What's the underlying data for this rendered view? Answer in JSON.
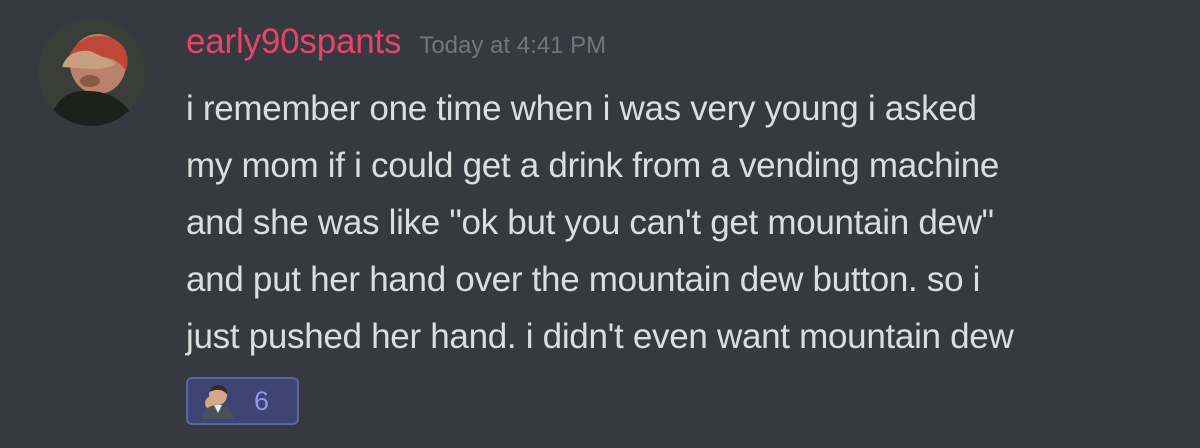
{
  "message": {
    "username": "early90spants",
    "timestamp": "Today at 4:41 PM",
    "lines": [
      "i remember one time when i was very young i asked",
      "my mom if i could get a drink from a vending machine",
      "and she was like \"ok but you can't get mountain dew\"",
      "and put her hand over the mountain dew button. so i",
      "just pushed her hand. i didn't even want mountain dew"
    ],
    "reaction": {
      "emoji": "man-emoji-icon",
      "count": "6"
    }
  },
  "colors": {
    "background": "#36393f",
    "username": "#e9436b",
    "timestamp": "#72767d",
    "text": "#dcddde",
    "reaction_bg": "#3e4474",
    "reaction_border": "#5d669b",
    "reaction_count": "#8e9ae6"
  }
}
